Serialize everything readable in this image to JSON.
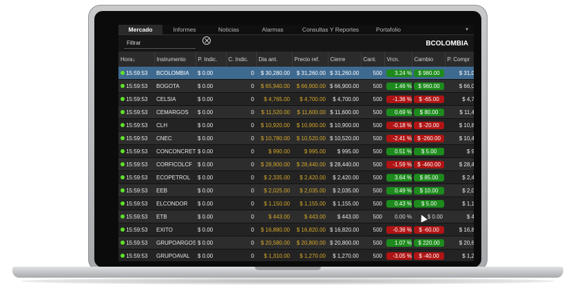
{
  "tabs": [
    "Mercado",
    "Informes",
    "Noticias",
    "Alarmas",
    "Consultas Y Reportes",
    "Portafolio"
  ],
  "filter": {
    "placeholder": "Filtrar"
  },
  "selected_symbol": "BCOLOMBIA",
  "columns": [
    "Hora",
    "Instrumento",
    "P. Indic.",
    "C. Indic.",
    "Dia ant.",
    "Precio ref.",
    "Cierre",
    "Cant.",
    "Vrcn.",
    "Cambio",
    "P. Compr"
  ],
  "sort_indicator": "↓",
  "colors": {
    "up": "#1c8a1c",
    "down": "#b01414",
    "selected_row": "#3f6a90",
    "status_dot": "#5fe22a",
    "gold": "#d8a92a"
  },
  "rows": [
    {
      "hora": "15:59:53",
      "inst": "BCOLOMBIA",
      "pind": "$ 0.00",
      "cind": "0",
      "dia": "$ 30,280.00",
      "ref": "$ 31,260.00",
      "cierre": "$ 31,260.00",
      "cant": "500",
      "vrcn": "3.24 %",
      "vrcn_dir": "up",
      "cambio": "$ 980.00",
      "cambio_dir": "up",
      "pcompr": "$ 31,0",
      "selected": true
    },
    {
      "hora": "15:59:53",
      "inst": "BOGOTA",
      "pind": "$ 0.00",
      "cind": "0",
      "dia": "$ 65,940.00",
      "ref": "$ 66,900.00",
      "cierre": "$ 66,900.00",
      "cant": "500",
      "vrcn": "1.46 %",
      "vrcn_dir": "up",
      "cambio": "$ 960.00",
      "cambio_dir": "up",
      "pcompr": "$ 66,0"
    },
    {
      "hora": "15:59:53",
      "inst": "CELSIA",
      "pind": "$ 0.00",
      "cind": "0",
      "dia": "$ 4,765.00",
      "ref": "$ 4,700.00",
      "cierre": "$ 4,700.00",
      "cant": "500",
      "vrcn": "-1.36 %",
      "vrcn_dir": "down",
      "cambio": "$ -65.00",
      "cambio_dir": "down",
      "pcompr": "$ 4,7"
    },
    {
      "hora": "15:59:53",
      "inst": "CEMARGOS",
      "pind": "$ 0.00",
      "cind": "0",
      "dia": "$ 11,520.00",
      "ref": "$ 11,600.00",
      "cierre": "$ 11,600.00",
      "cant": "500",
      "vrcn": "0.69 %",
      "vrcn_dir": "up",
      "cambio": "$ 80.00",
      "cambio_dir": "up",
      "pcompr": "$ 11,4"
    },
    {
      "hora": "15:59:53",
      "inst": "CLH",
      "pind": "$ 0.00",
      "cind": "0",
      "dia": "$ 10,920.00",
      "ref": "$ 10,900.00",
      "cierre": "$ 10,900.00",
      "cant": "500",
      "vrcn": "-0.18 %",
      "vrcn_dir": "down",
      "cambio": "$ -20.00",
      "cambio_dir": "down",
      "pcompr": "$ 10,8"
    },
    {
      "hora": "15:59:53",
      "inst": "CNEC",
      "pind": "$ 0.00",
      "cind": "0",
      "dia": "$ 10,780.00",
      "ref": "$ 10,520.00",
      "cierre": "$ 10,520.00",
      "cant": "500",
      "vrcn": "-2.41 %",
      "vrcn_dir": "down",
      "cambio": "$ -260.00",
      "cambio_dir": "down",
      "pcompr": "$ 10,4"
    },
    {
      "hora": "15:59:53",
      "inst": "CONCONCRET",
      "pind": "$ 0.00",
      "cind": "0",
      "dia": "$ 990.00",
      "ref": "$ 995.00",
      "cierre": "$ 995.00",
      "cant": "500",
      "vrcn": "0.51 %",
      "vrcn_dir": "up",
      "cambio": "$ 5.00",
      "cambio_dir": "up",
      "pcompr": "$ 9"
    },
    {
      "hora": "15:59:53",
      "inst": "CORFICOLCF",
      "pind": "$ 0.00",
      "cind": "0",
      "dia": "$ 28,900.00",
      "ref": "$ 28,440.00",
      "cierre": "$ 28,440.00",
      "cant": "500",
      "vrcn": "-1.59 %",
      "vrcn_dir": "down",
      "cambio": "$ -460.00",
      "cambio_dir": "down",
      "pcompr": "$ 28,4"
    },
    {
      "hora": "15:59:53",
      "inst": "ECOPETROL",
      "pind": "$ 0.00",
      "cind": "0",
      "dia": "$ 2,335.00",
      "ref": "$ 2,420.00",
      "cierre": "$ 2,420.00",
      "cant": "500",
      "vrcn": "3.64 %",
      "vrcn_dir": "up",
      "cambio": "$ 85.00",
      "cambio_dir": "up",
      "pcompr": "$ 2,4"
    },
    {
      "hora": "15:59:53",
      "inst": "EEB",
      "pind": "$ 0.00",
      "cind": "0",
      "dia": "$ 2,025.00",
      "ref": "$ 2,035.00",
      "cierre": "$ 2,035.00",
      "cant": "500",
      "vrcn": "0.49 %",
      "vrcn_dir": "up",
      "cambio": "$ 10.00",
      "cambio_dir": "up",
      "pcompr": "$ 2,0"
    },
    {
      "hora": "15:59:53",
      "inst": "ELCONDOR",
      "pind": "$ 0.00",
      "cind": "0",
      "dia": "$ 1,150.00",
      "ref": "$ 1,155.00",
      "cierre": "$ 1,155.00",
      "cant": "500",
      "vrcn": "0.43 %",
      "vrcn_dir": "up",
      "cambio": "$ 5.00",
      "cambio_dir": "up",
      "pcompr": "$ 1,1"
    },
    {
      "hora": "15:59:53",
      "inst": "ETB",
      "pind": "$ 0.00",
      "cind": "0",
      "dia": "$ 443.00",
      "ref": "$ 443.00",
      "cierre": "$ 443.00",
      "cant": "500",
      "vrcn": "0.00 %",
      "vrcn_dir": "flat",
      "cambio": "$ 0.00",
      "cambio_dir": "flat",
      "pcompr": "$ 4"
    },
    {
      "hora": "15:59:53",
      "inst": "EXITO",
      "pind": "$ 0.00",
      "cind": "0",
      "dia": "$ 16,880.00",
      "ref": "$ 16,820.00",
      "cierre": "$ 16,820.00",
      "cant": "500",
      "vrcn": "-0.36 %",
      "vrcn_dir": "down",
      "cambio": "$ -60.00",
      "cambio_dir": "down",
      "pcompr": "$ 16,8"
    },
    {
      "hora": "15:59:53",
      "inst": "GRUPOARGOS",
      "pind": "$ 0.00",
      "cind": "0",
      "dia": "$ 20,580.00",
      "ref": "$ 20,800.00",
      "cierre": "$ 20,800.00",
      "cant": "500",
      "vrcn": "1.07 %",
      "vrcn_dir": "up",
      "cambio": "$ 220.00",
      "cambio_dir": "up",
      "pcompr": "$ 20,6"
    },
    {
      "hora": "15:59:53",
      "inst": "GRUPOAVAL",
      "pind": "$ 0.00",
      "cind": "0",
      "dia": "$ 1,310.00",
      "ref": "$ 1,270.00",
      "cierre": "$ 1,270.00",
      "cant": "500",
      "vrcn": "-3.05 %",
      "vrcn_dir": "down",
      "cambio": "$ -40.00",
      "cambio_dir": "down",
      "pcompr": "$ 1,2"
    }
  ]
}
